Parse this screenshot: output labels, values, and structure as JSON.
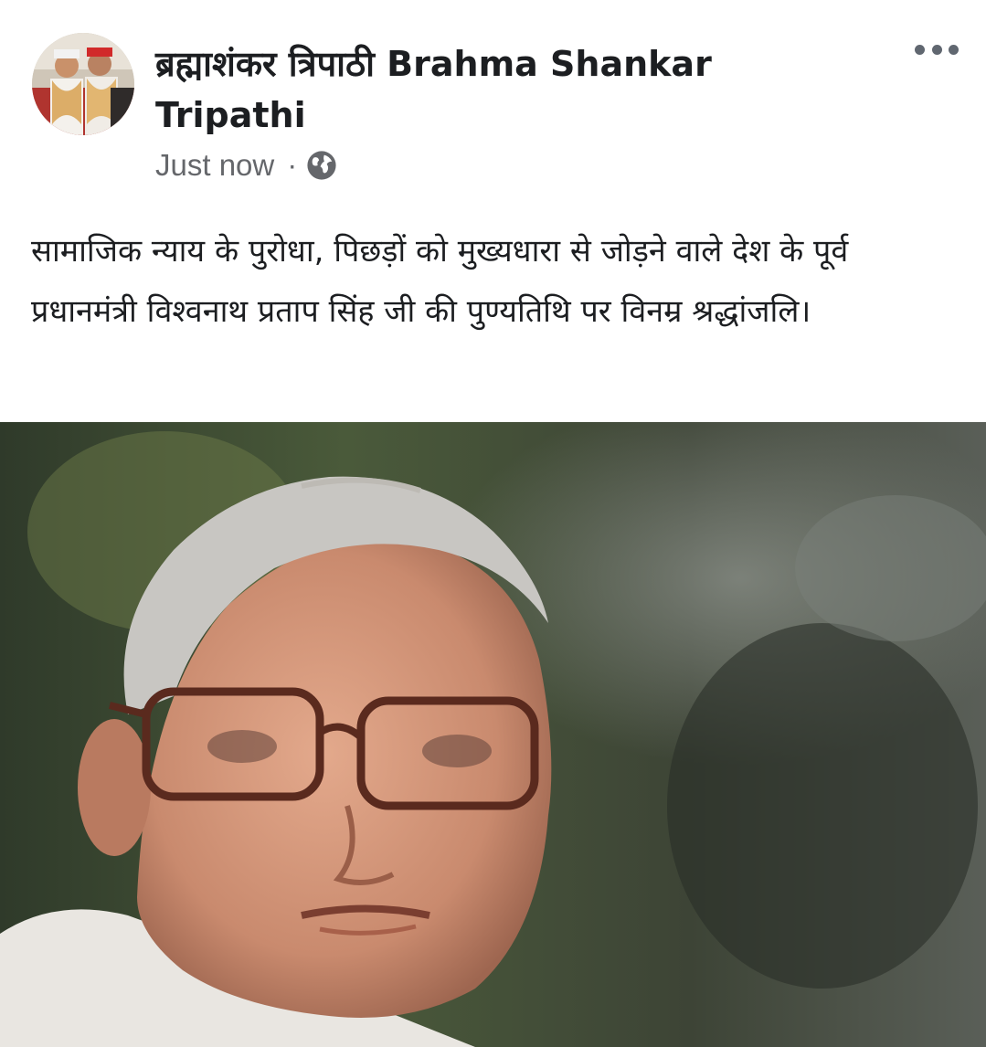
{
  "post": {
    "author": "ब्रह्माशंकर त्रिपाठी Brahma Shankar Tripathi",
    "timestamp": "Just now",
    "separator": "·",
    "audience_icon": "globe-icon",
    "menu_icon": "more-options-icon",
    "text": "सामाजिक न्याय के पुरोधा, पिछड़ों को मुख्यधारा से जोड़ने वाले देश के पूर्व प्रधानमंत्री विश्वनाथ प्रताप सिंह जी की पुण्यतिथि पर विनम्र श्रद्धांजलि।"
  },
  "colors": {
    "name_text": "#1c1e21",
    "meta_text": "#65676b",
    "background": "#ffffff"
  }
}
